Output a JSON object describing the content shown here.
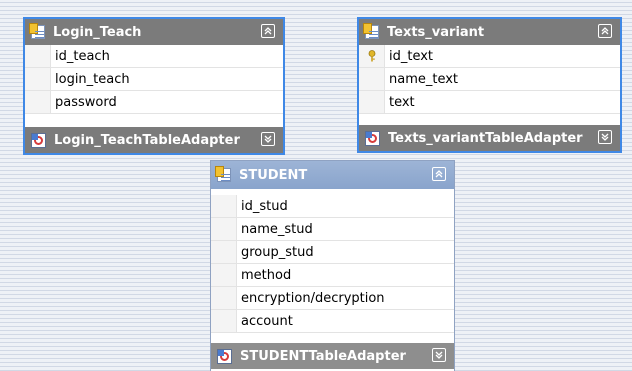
{
  "tables": [
    {
      "id": "login-teach",
      "title": "Login_Teach",
      "columns": [
        "id_teach",
        "login_teach",
        "password"
      ],
      "key_column_index": null,
      "adapter": "Login_TeachTableAdapter"
    },
    {
      "id": "texts-variant",
      "title": "Texts_variant",
      "columns": [
        "id_text",
        "name_text",
        "text"
      ],
      "key_column_index": 0,
      "adapter": "Texts_variantTableAdapter"
    },
    {
      "id": "student",
      "title": "STUDENT",
      "columns": [
        "id_stud",
        "name_stud",
        "group_stud",
        "method",
        "encryption/decryption",
        "account"
      ],
      "key_column_index": null,
      "adapter": "STUDENTTableAdapter"
    }
  ],
  "icons": {
    "table": "table-icon",
    "adapter": "table-adapter-icon",
    "collapse": "chevron-up-double-icon",
    "expand": "chevron-down-double-icon",
    "key": "primary-key-icon"
  },
  "colors": {
    "selection_border": "#3f88e6",
    "header_dark": "#7b7b7b",
    "header_blue": "#89a4cc",
    "background": "#eef1f6"
  }
}
